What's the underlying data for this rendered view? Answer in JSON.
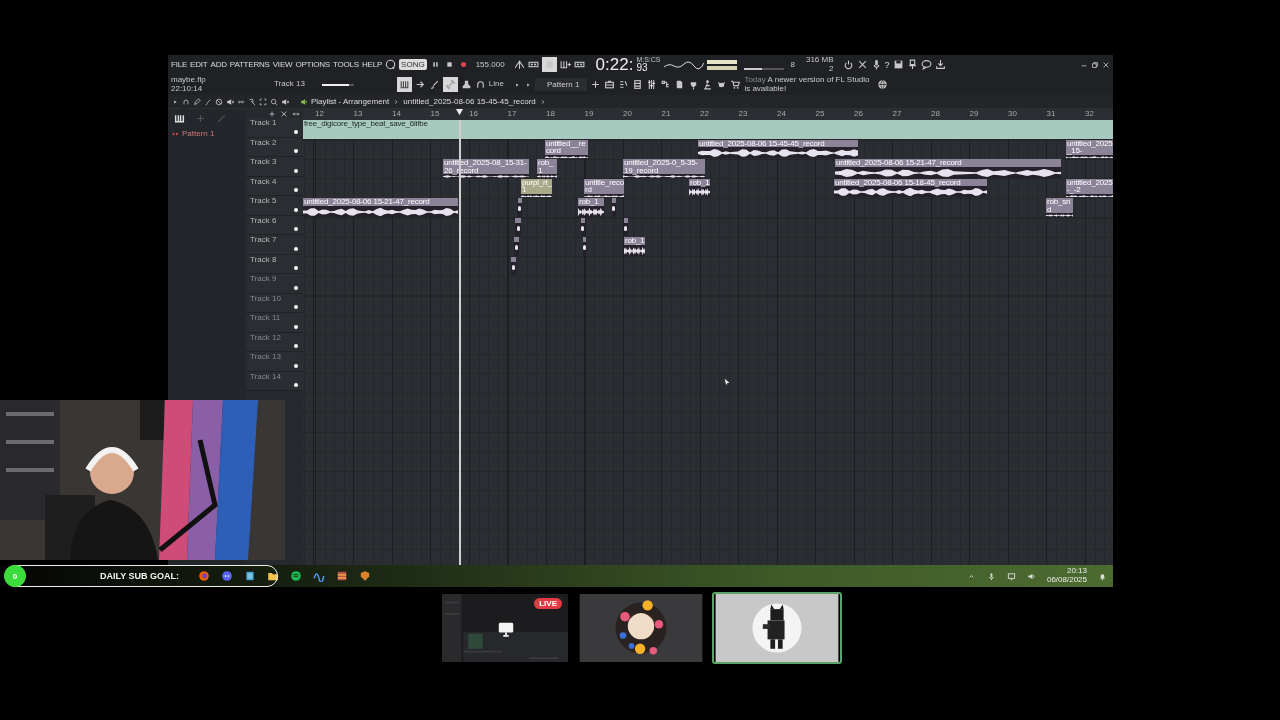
{
  "daw": {
    "menu": [
      "FILE",
      "EDIT",
      "ADD",
      "PATTERNS",
      "VIEW",
      "OPTIONS",
      "TOOLS",
      "HELP"
    ],
    "song_mode": "SONG",
    "tempo": "155.000",
    "time": {
      "main": "0:22:",
      "fraction": "93",
      "unit": "M:S:CS"
    },
    "pitch": {
      "level": 0.45
    },
    "volume": {
      "level": 0.85
    },
    "meter_reading": "8",
    "memory": "316 MB",
    "voices": "2",
    "help": "?",
    "project": {
      "file": "maybe.flp",
      "time": "22:10:14"
    },
    "hint_track": "Track 13",
    "snap": "Line",
    "pattern": "Pattern 1",
    "news": {
      "day": "Today",
      "message": "A newer version of FL Studio is available!"
    },
    "breadcrumb": [
      "Playlist - Arrangement",
      "untitled_2025-08-06 15-45-45_record"
    ],
    "pattern_list": [
      "Pattern 1"
    ],
    "ruler": [
      "12",
      "13",
      "14",
      "15",
      "16",
      "17",
      "18",
      "19",
      "20",
      "21",
      "22",
      "23",
      "24",
      "25",
      "26",
      "27",
      "28",
      "29",
      "30",
      "31",
      "32"
    ],
    "tracks": [
      {
        "name": "Track 1",
        "clips": [
          {
            "kind": "band",
            "name": "free_digicore_type_beat_save_6lifbe",
            "color": "#a8c9bd"
          }
        ]
      },
      {
        "name": "Track 2",
        "clips": [
          {
            "kind": "audio",
            "name": "untitled__record",
            "color": "#8c8399"
          },
          {
            "kind": "audio",
            "name": "untitled_2025-08-06 15-45-45_record",
            "color": "#8c8399"
          },
          {
            "kind": "audio",
            "name": "untitled_2025_15-",
            "color": "#8c8399"
          }
        ]
      },
      {
        "name": "Track 3",
        "clips": [
          {
            "kind": "audio",
            "name": "untitled_2025-08_15-31-26_record",
            "color": "#8c8399"
          },
          {
            "kind": "audio",
            "name": "rob_1",
            "color": "#8c8399"
          },
          {
            "kind": "audio",
            "name": "untitled_2025-0_5-35-19_record",
            "color": "#8c8399"
          },
          {
            "kind": "audio",
            "name": "untitled_2025-08-06 15-21-47_record",
            "color": "#8c8399"
          }
        ]
      },
      {
        "name": "Track 4",
        "clips": [
          {
            "kind": "audio",
            "name": "purpl_rt_1",
            "color": "#a9a98a"
          },
          {
            "kind": "audio",
            "name": "untitle_record",
            "color": "#8c8399"
          },
          {
            "kind": "audio",
            "name": "rob_1",
            "color": "#8c8399"
          },
          {
            "kind": "audio",
            "name": "untitled_2025-08-06 15-18-45_record",
            "color": "#8c8399"
          },
          {
            "kind": "audio",
            "name": "untitled_2025-_-2",
            "color": "#8c8399"
          }
        ]
      },
      {
        "name": "Track 5",
        "clips": [
          {
            "kind": "audio",
            "name": "untitled_2025-08-06 15-21-47_record",
            "color": "#8c8399"
          },
          {
            "kind": "stub",
            "color": "#8c8399"
          },
          {
            "kind": "audio",
            "name": "rob_1",
            "color": "#8c8399"
          },
          {
            "kind": "stub",
            "color": "#8c8399"
          },
          {
            "kind": "audio",
            "name": "rob_snd",
            "color": "#8c8399"
          }
        ]
      },
      {
        "name": "Track 6",
        "clips": [
          {
            "kind": "stub",
            "color": "#8c8399"
          },
          {
            "kind": "stub",
            "color": "#8c8399"
          },
          {
            "kind": "stub",
            "color": "#8c8399"
          }
        ]
      },
      {
        "name": "Track 7",
        "clips": [
          {
            "kind": "stub",
            "color": "#8c8399"
          },
          {
            "kind": "stub",
            "color": "#8c8399"
          },
          {
            "kind": "audio",
            "name": "rob_1",
            "color": "#8c8399"
          }
        ]
      },
      {
        "name": "Track 8",
        "clips": [
          {
            "kind": "stub",
            "color": "#8c8399"
          }
        ]
      },
      {
        "name": "Track 9"
      },
      {
        "name": "Track 10"
      },
      {
        "name": "Track 11"
      },
      {
        "name": "Track 12"
      },
      {
        "name": "Track 13"
      },
      {
        "name": "Track 14"
      }
    ]
  },
  "taskbar": {
    "clock": "20:13",
    "date": "06/08/2025"
  },
  "sub_goal": {
    "count": "0",
    "label": "DAILY SUB GOAL:"
  },
  "call_tiles": [
    {
      "kind": "screen",
      "badge": "LIVE",
      "selected": false
    },
    {
      "kind": "avatar",
      "selected": false
    },
    {
      "kind": "figure",
      "selected": true
    }
  ]
}
